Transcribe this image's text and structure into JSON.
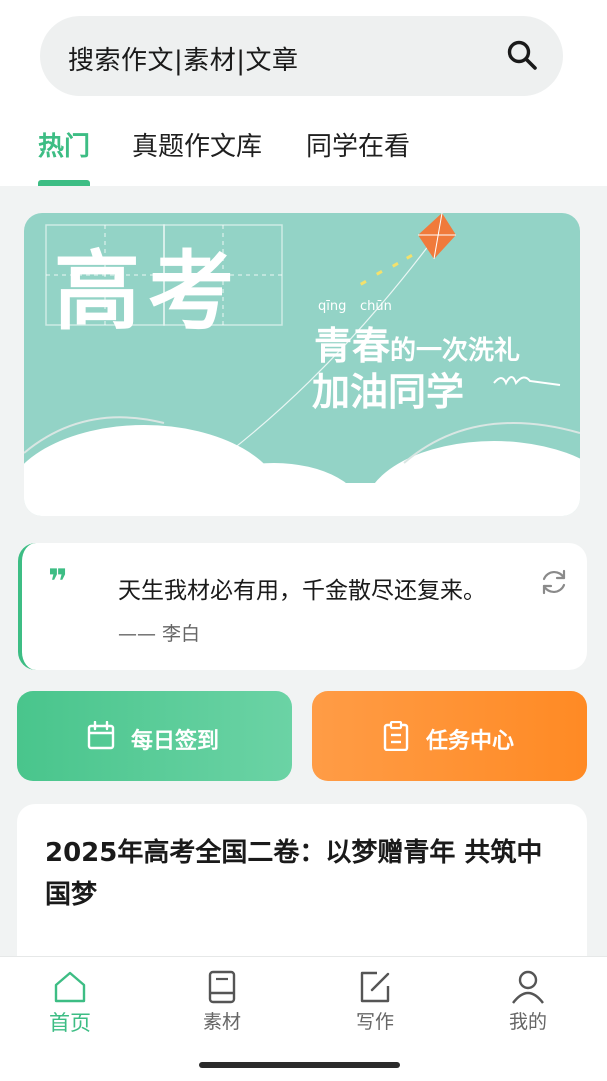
{
  "search": {
    "placeholder": "搜索作文|素材|文章"
  },
  "tabs": [
    {
      "label": "热门",
      "active": true
    },
    {
      "label": "真题作文库",
      "active": false
    },
    {
      "label": "同学在看",
      "active": false
    }
  ],
  "banner": {
    "title": "高考",
    "pinyin_1": "qīng",
    "pinyin_2": "chūn",
    "line1_main": "青春",
    "line1_rest": "的一次洗礼",
    "line2": "加油同学"
  },
  "quote": {
    "text": "天生我材必有用，千金散尽还复来。",
    "author": "—— 李白"
  },
  "actions": {
    "checkin_label": "每日签到",
    "task_label": "任务中心"
  },
  "article": {
    "title": "2025年高考全国二卷：以梦赠青年 共筑中国梦"
  },
  "bottom_nav": [
    {
      "label": "首页",
      "icon": "home-icon",
      "active": true
    },
    {
      "label": "素材",
      "icon": "book-icon",
      "active": false
    },
    {
      "label": "写作",
      "icon": "edit-icon",
      "active": false
    },
    {
      "label": "我的",
      "icon": "user-icon",
      "active": false
    }
  ],
  "colors": {
    "accent": "#3dbd84",
    "checkin_bg": "#49c58c",
    "task_bg": "#ff8a24",
    "banner_bg": "#93d3c6"
  }
}
